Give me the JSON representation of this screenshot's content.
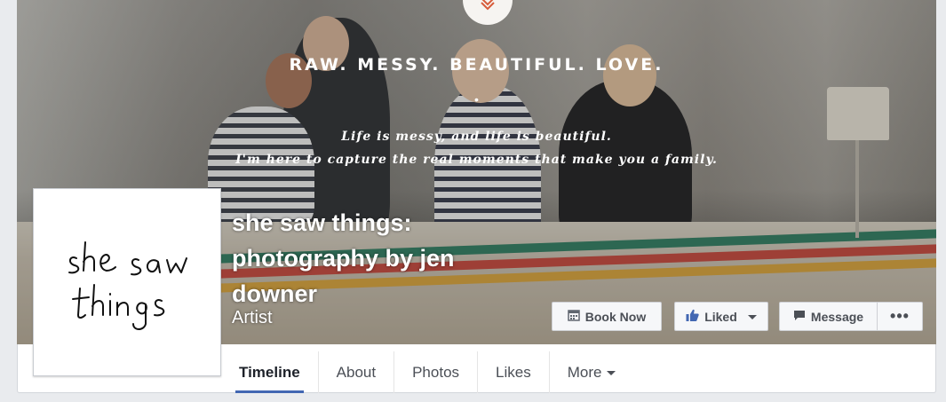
{
  "cover": {
    "tagline": "RAW. MESSY. BEAUTIFUL. LOVE.",
    "dot": "•",
    "quote_line1": "Life is messy, and life is beautiful.",
    "quote_line2": "I'm here to capture the real moments that make you a family.",
    "logo_icon": "chevron-v-logo"
  },
  "page": {
    "name": "she saw things: photography by jen downer",
    "category": "Artist",
    "profile_logo_text": "she saw things"
  },
  "actions": {
    "book_now": "Book Now",
    "liked": "Liked",
    "message": "Message",
    "more": "•••"
  },
  "tabs": [
    {
      "label": "Timeline",
      "active": true
    },
    {
      "label": "About"
    },
    {
      "label": "Photos"
    },
    {
      "label": "Likes"
    },
    {
      "label": "More"
    }
  ],
  "colors": {
    "accent": "#4267b2",
    "logo_orange": "#d75b3a"
  }
}
